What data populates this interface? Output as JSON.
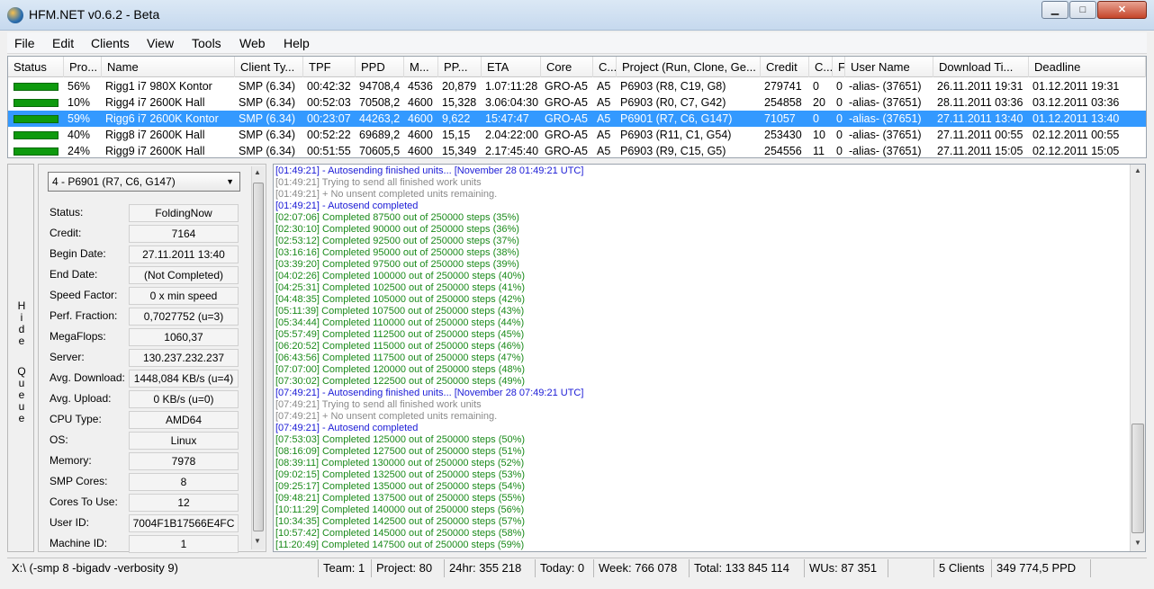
{
  "window": {
    "title": "HFM.NET v0.6.2 - Beta",
    "min_glyph": "▁",
    "max_glyph": "□",
    "close_glyph": "✕"
  },
  "menu": [
    "File",
    "Edit",
    "Clients",
    "View",
    "Tools",
    "Web",
    "Help"
  ],
  "grid": {
    "columns": [
      "Status",
      "Pro...",
      "Name",
      "Client Ty...",
      "TPF",
      "PPD",
      "M...",
      "PP...",
      "ETA",
      "Core",
      "C...",
      "Project (Run, Clone, Ge...",
      "Credit",
      "C...",
      "F",
      "User Name",
      "Download Ti...",
      "Deadline"
    ],
    "rows": [
      [
        "",
        "56%",
        "Rigg1 i7 980X Kontor",
        "SMP (6.34)",
        "00:42:32",
        "94708,4",
        "4536",
        "20,879",
        "1.07:11:28",
        "GRO-A5",
        "A5",
        "P6903 (R8, C19, G8)",
        "279741",
        "0",
        "0",
        "-alias- (37651)",
        "26.11.2011 19:31",
        "01.12.2011 19:31"
      ],
      [
        "",
        "10%",
        "Rigg4 i7 2600K Hall",
        "SMP (6.34)",
        "00:52:03",
        "70508,2",
        "4600",
        "15,328",
        "3.06:04:30",
        "GRO-A5",
        "A5",
        "P6903 (R0, C7, G42)",
        "254858",
        "20",
        "0",
        "-alias- (37651)",
        "28.11.2011 03:36",
        "03.12.2011 03:36"
      ],
      [
        "",
        "59%",
        "Rigg6 i7 2600K Kontor",
        "SMP (6.34)",
        "00:23:07",
        "44263,2",
        "4600",
        "9,622",
        "15:47:47",
        "GRO-A5",
        "A5",
        "P6901 (R7, C6, G147)",
        "71057",
        "0",
        "0",
        "-alias- (37651)",
        "27.11.2011 13:40",
        "01.12.2011 13:40"
      ],
      [
        "",
        "40%",
        "Rigg8 i7 2600K Hall",
        "SMP (6.34)",
        "00:52:22",
        "69689,2",
        "4600",
        "15,15",
        "2.04:22:00",
        "GRO-A5",
        "A5",
        "P6903 (R11, C1, G54)",
        "253430",
        "10",
        "0",
        "-alias- (37651)",
        "27.11.2011 00:55",
        "02.12.2011 00:55"
      ],
      [
        "",
        "24%",
        "Rigg9 i7 2600K Hall",
        "SMP (6.34)",
        "00:51:55",
        "70605,5",
        "4600",
        "15,349",
        "2.17:45:40",
        "GRO-A5",
        "A5",
        "P6903 (R9, C15, G5)",
        "254556",
        "11",
        "0",
        "-alias- (37651)",
        "27.11.2011 15:05",
        "02.12.2011 15:05"
      ]
    ],
    "status_color": "#0e9a0e",
    "selected_index": 2
  },
  "hide_queue": "Hide Queue",
  "queue": {
    "selected": "4 - P6901 (R7, C6, G147)",
    "fields": [
      {
        "label": "Status:",
        "value": "FoldingNow"
      },
      {
        "label": "Credit:",
        "value": "7164"
      },
      {
        "label": "Begin Date:",
        "value": "27.11.2011 13:40"
      },
      {
        "label": "End Date:",
        "value": "(Not Completed)"
      },
      {
        "label": "Speed Factor:",
        "value": "0 x min speed"
      },
      {
        "label": "Perf. Fraction:",
        "value": "0,7027752 (u=3)"
      },
      {
        "label": "MegaFlops:",
        "value": "1060,37"
      },
      {
        "label": "Server:",
        "value": "130.237.232.237"
      },
      {
        "label": "Avg. Download:",
        "value": "1448,084 KB/s (u=4)"
      },
      {
        "label": "Avg. Upload:",
        "value": "0 KB/s (u=0)"
      },
      {
        "label": "CPU Type:",
        "value": "AMD64"
      },
      {
        "label": "OS:",
        "value": "Linux"
      },
      {
        "label": "Memory:",
        "value": "7978"
      },
      {
        "label": "SMP Cores:",
        "value": "8"
      },
      {
        "label": "Cores To Use:",
        "value": "12"
      },
      {
        "label": "User ID:",
        "value": "7004F1B17566E4FC"
      },
      {
        "label": "Machine ID:",
        "value": "1"
      }
    ]
  },
  "log": [
    {
      "t": "[01:49:21] - Autosending finished units... [November 28 01:49:21 UTC]",
      "c": "blue"
    },
    {
      "t": "[01:49:21] Trying to send all finished work units",
      "c": "gray"
    },
    {
      "t": "[01:49:21] + No unsent completed units remaining.",
      "c": "gray"
    },
    {
      "t": "[01:49:21] - Autosend completed",
      "c": "blue"
    },
    {
      "t": "[02:07:06] Completed 87500 out of 250000 steps  (35%)",
      "c": "green"
    },
    {
      "t": "[02:30:10] Completed 90000 out of 250000 steps  (36%)",
      "c": "green"
    },
    {
      "t": "[02:53:12] Completed 92500 out of 250000 steps  (37%)",
      "c": "green"
    },
    {
      "t": "[03:16:16] Completed 95000 out of 250000 steps  (38%)",
      "c": "green"
    },
    {
      "t": "[03:39:20] Completed 97500 out of 250000 steps  (39%)",
      "c": "green"
    },
    {
      "t": "[04:02:26] Completed 100000 out of 250000 steps  (40%)",
      "c": "green"
    },
    {
      "t": "[04:25:31] Completed 102500 out of 250000 steps  (41%)",
      "c": "green"
    },
    {
      "t": "[04:48:35] Completed 105000 out of 250000 steps  (42%)",
      "c": "green"
    },
    {
      "t": "[05:11:39] Completed 107500 out of 250000 steps  (43%)",
      "c": "green"
    },
    {
      "t": "[05:34:44] Completed 110000 out of 250000 steps  (44%)",
      "c": "green"
    },
    {
      "t": "[05:57:49] Completed 112500 out of 250000 steps  (45%)",
      "c": "green"
    },
    {
      "t": "[06:20:52] Completed 115000 out of 250000 steps  (46%)",
      "c": "green"
    },
    {
      "t": "[06:43:56] Completed 117500 out of 250000 steps  (47%)",
      "c": "green"
    },
    {
      "t": "[07:07:00] Completed 120000 out of 250000 steps  (48%)",
      "c": "green"
    },
    {
      "t": "[07:30:02] Completed 122500 out of 250000 steps  (49%)",
      "c": "green"
    },
    {
      "t": "[07:49:21] - Autosending finished units... [November 28 07:49:21 UTC]",
      "c": "blue"
    },
    {
      "t": "[07:49:21] Trying to send all finished work units",
      "c": "gray"
    },
    {
      "t": "[07:49:21] + No unsent completed units remaining.",
      "c": "gray"
    },
    {
      "t": "[07:49:21] - Autosend completed",
      "c": "blue"
    },
    {
      "t": "[07:53:03] Completed 125000 out of 250000 steps  (50%)",
      "c": "green"
    },
    {
      "t": "[08:16:09] Completed 127500 out of 250000 steps  (51%)",
      "c": "green"
    },
    {
      "t": "[08:39:11] Completed 130000 out of 250000 steps  (52%)",
      "c": "green"
    },
    {
      "t": "[09:02:15] Completed 132500 out of 250000 steps  (53%)",
      "c": "green"
    },
    {
      "t": "[09:25:17] Completed 135000 out of 250000 steps  (54%)",
      "c": "green"
    },
    {
      "t": "[09:48:21] Completed 137500 out of 250000 steps  (55%)",
      "c": "green"
    },
    {
      "t": "[10:11:29] Completed 140000 out of 250000 steps  (56%)",
      "c": "green"
    },
    {
      "t": "[10:34:35] Completed 142500 out of 250000 steps  (57%)",
      "c": "green"
    },
    {
      "t": "[10:57:42] Completed 145000 out of 250000 steps  (58%)",
      "c": "green"
    },
    {
      "t": "[11:20:49] Completed 147500 out of 250000 steps  (59%)",
      "c": "green"
    }
  ],
  "statusbar": [
    "X:\\ (-smp 8 -bigadv -verbosity 9)",
    "Team: 1",
    "Project: 80",
    "24hr: 355 218",
    "Today: 0",
    "Week: 766 078",
    "Total: 133 845 114",
    "WUs: 87 351",
    "",
    "5 Clients",
    "349 774,5 PPD"
  ],
  "colors": {
    "log_blue": "#1a1ad6",
    "log_gray": "#8a8a8a",
    "log_green": "#1a8a1a",
    "selection": "#3399ff"
  }
}
